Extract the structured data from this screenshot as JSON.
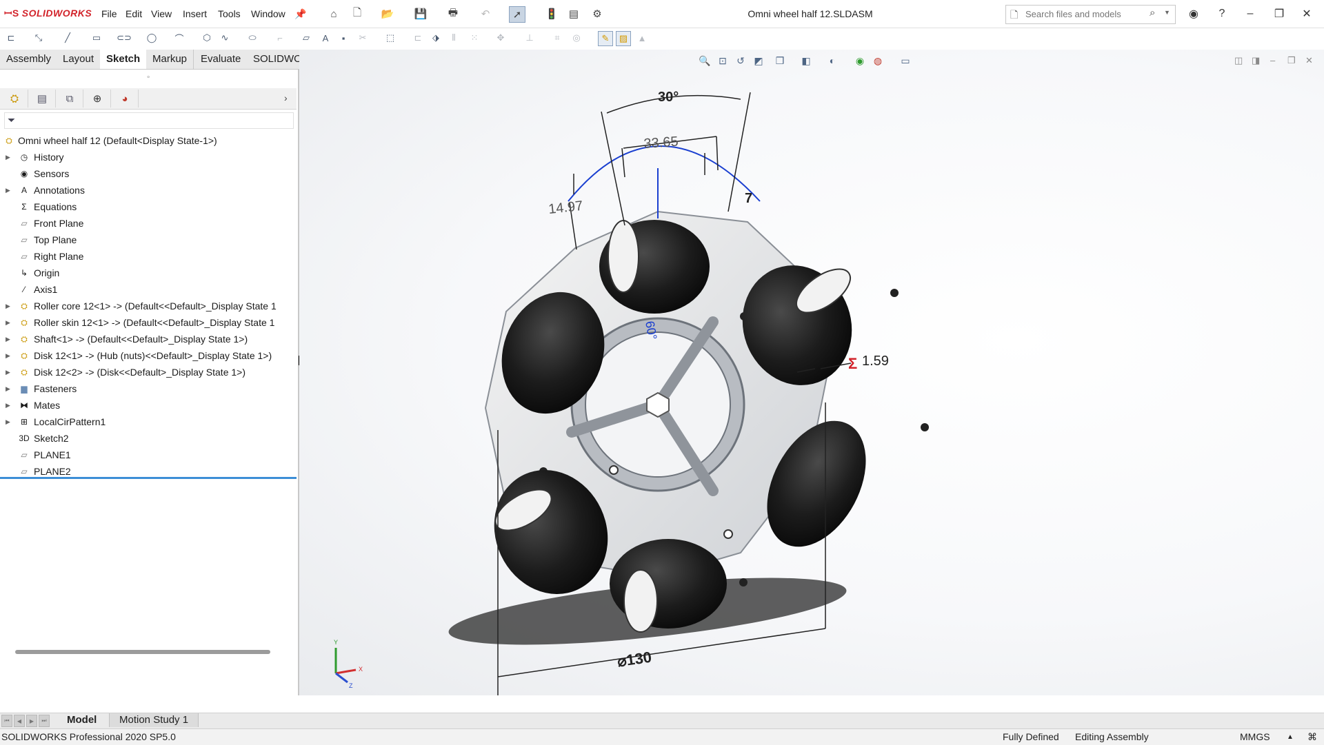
{
  "app": {
    "name": "SOLIDWORKS"
  },
  "document": {
    "title": "Omni wheel half 12.SLDASM"
  },
  "menu": [
    "File",
    "Edit",
    "View",
    "Insert",
    "Tools",
    "Window"
  ],
  "search": {
    "placeholder": "Search files and models"
  },
  "tabs": [
    {
      "label": "Assembly",
      "active": false
    },
    {
      "label": "Layout",
      "active": false
    },
    {
      "label": "Sketch",
      "active": true
    },
    {
      "label": "Markup",
      "active": false
    },
    {
      "label": "Evaluate",
      "active": false
    },
    {
      "label": "SOLIDWORKS Add-Ins",
      "active": false
    }
  ],
  "tree": {
    "root": "Omni wheel half 12  (Default<Display State-1>)",
    "items": [
      {
        "label": "History",
        "icon": "history-folder-icon",
        "expandable": true
      },
      {
        "label": "Sensors",
        "icon": "sensors-folder-icon",
        "expandable": false
      },
      {
        "label": "Annotations",
        "icon": "annotations-folder-icon",
        "expandable": true
      },
      {
        "label": "Equations",
        "icon": "equations-folder-icon",
        "expandable": false
      },
      {
        "label": "Front Plane",
        "icon": "plane-icon",
        "expandable": false
      },
      {
        "label": "Top Plane",
        "icon": "plane-icon",
        "expandable": false
      },
      {
        "label": "Right Plane",
        "icon": "plane-icon",
        "expandable": false
      },
      {
        "label": "Origin",
        "icon": "origin-icon",
        "expandable": false
      },
      {
        "label": "Axis1",
        "icon": "axis-icon",
        "expandable": false
      },
      {
        "label": "Roller core 12<1> -> (Default<<Default>_Display State 1",
        "icon": "component-icon",
        "expandable": true
      },
      {
        "label": "Roller skin 12<1> -> (Default<<Default>_Display State 1",
        "icon": "component-icon",
        "expandable": true
      },
      {
        "label": "Shaft<1> -> (Default<<Default>_Display State 1>)",
        "icon": "component-icon",
        "expandable": true
      },
      {
        "label": "Disk 12<1> -> (Hub (nuts)<<Default>_Display State 1>)",
        "icon": "component-icon",
        "expandable": true
      },
      {
        "label": "Disk 12<2> -> (Disk<<Default>_Display State 1>)",
        "icon": "component-icon",
        "expandable": true
      },
      {
        "label": "Fasteners",
        "icon": "folder-icon",
        "expandable": true
      },
      {
        "label": "Mates",
        "icon": "mates-icon",
        "expandable": true
      },
      {
        "label": "LocalCirPattern1",
        "icon": "circular-pattern-icon",
        "expandable": true
      },
      {
        "label": "Sketch2",
        "icon": "3d-sketch-icon",
        "expandable": false
      },
      {
        "label": "PLANE1",
        "icon": "plane-icon",
        "expandable": false
      },
      {
        "label": "PLANE2",
        "icon": "plane-icon",
        "expandable": false
      }
    ]
  },
  "dimensions": {
    "angle": "30°",
    "width": "33.65",
    "height": "14.97",
    "seven": "7",
    "thickness": "1.59",
    "diameter": "⌀130",
    "sixty": "60°"
  },
  "triad": {
    "x": "X",
    "y": "Y",
    "z": "Z"
  },
  "bottom_tabs": [
    {
      "label": "Model",
      "active": true
    },
    {
      "label": "Motion Study 1",
      "active": false
    }
  ],
  "status": {
    "product": "SOLIDWORKS Professional 2020 SP5.0",
    "definition": "Fully Defined",
    "mode": "Editing Assembly",
    "units": "MMGS"
  },
  "colors": {
    "brand": "#d2232a",
    "tree_selection": "#3c8ed6",
    "sketch_blue": "#1a3fd0",
    "dimension_red": "#d2232a"
  }
}
